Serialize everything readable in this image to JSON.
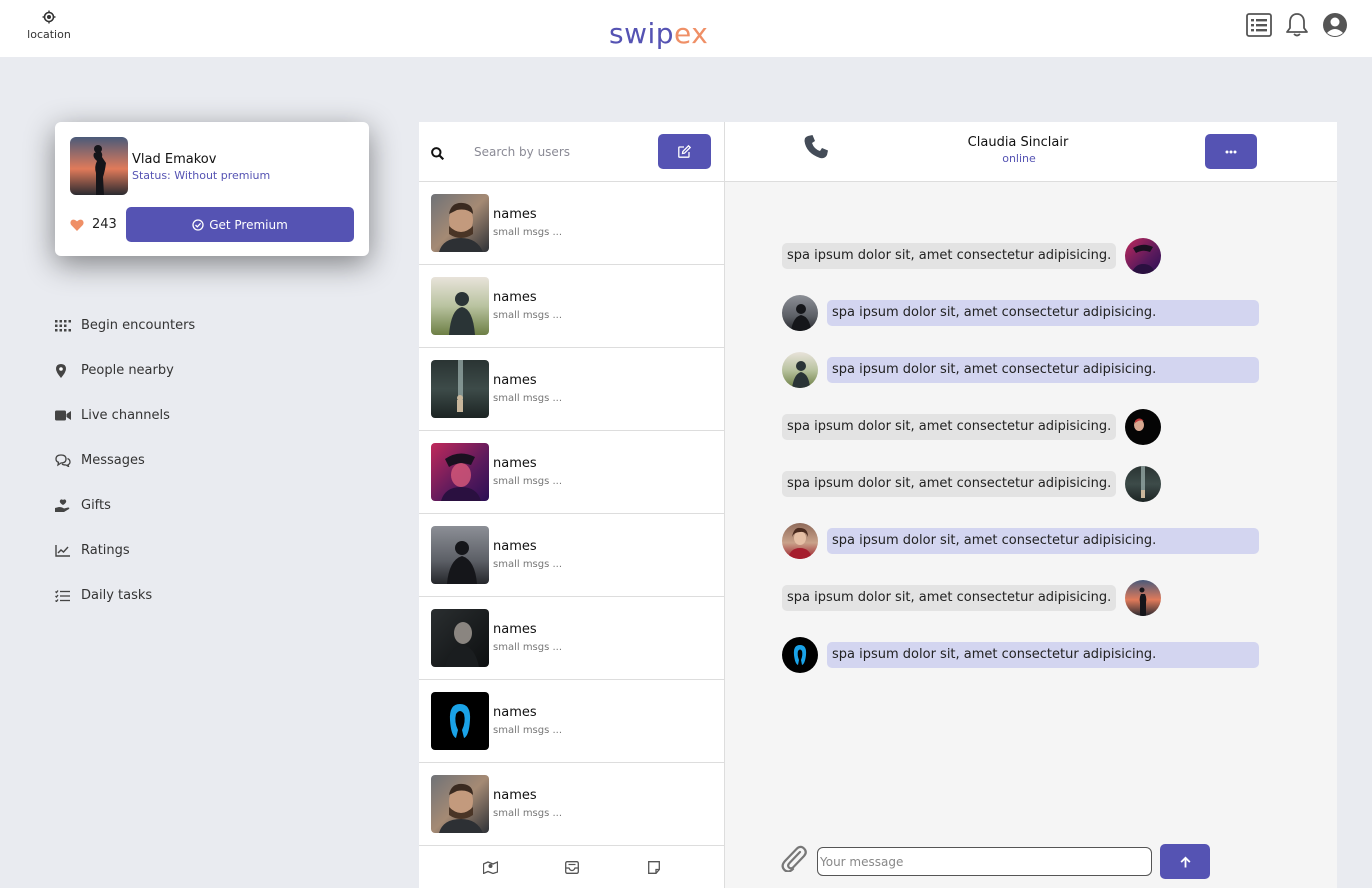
{
  "header": {
    "location_label": "location",
    "logo_part1": "swip",
    "logo_part2": "ex"
  },
  "profile": {
    "name": "Vlad Emakov",
    "status_label": "Status: Without premium",
    "likes": "243",
    "premium_button": "Get Premium"
  },
  "nav": {
    "items": [
      {
        "label": "Begin encounters",
        "icon": "grid-icon"
      },
      {
        "label": "People nearby",
        "icon": "map-pin-icon"
      },
      {
        "label": "Live channels",
        "icon": "video-camera-icon"
      },
      {
        "label": "Messages",
        "icon": "chat-bubbles-icon"
      },
      {
        "label": "Gifts",
        "icon": "hand-gift-icon"
      },
      {
        "label": "Ratings",
        "icon": "chart-line-icon"
      },
      {
        "label": "Daily tasks",
        "icon": "task-list-icon"
      }
    ]
  },
  "conversations": {
    "search_placeholder": "Search by users",
    "items": [
      {
        "name": "names",
        "preview": "small msgs ..."
      },
      {
        "name": "names",
        "preview": "small msgs ..."
      },
      {
        "name": "names",
        "preview": "small msgs ..."
      },
      {
        "name": "names",
        "preview": "small msgs ..."
      },
      {
        "name": "names",
        "preview": "small msgs ..."
      },
      {
        "name": "names",
        "preview": "small msgs ..."
      },
      {
        "name": "names",
        "preview": "small msgs ..."
      },
      {
        "name": "names",
        "preview": "small msgs ..."
      }
    ]
  },
  "chat": {
    "contact_name": "Claudia Sinclair",
    "contact_status": "online",
    "messages": [
      {
        "direction": "in",
        "text": "spa ipsum dolor sit, amet consectetur adipisicing."
      },
      {
        "direction": "out",
        "text": "spa ipsum dolor sit, amet consectetur adipisicing."
      },
      {
        "direction": "out",
        "text": "spa ipsum dolor sit, amet consectetur adipisicing."
      },
      {
        "direction": "in",
        "text": "spa ipsum dolor sit, amet consectetur adipisicing."
      },
      {
        "direction": "in",
        "text": "spa ipsum dolor sit, amet consectetur adipisicing."
      },
      {
        "direction": "out",
        "text": "spa ipsum dolor sit, amet consectetur adipisicing."
      },
      {
        "direction": "in",
        "text": "spa ipsum dolor sit, amet consectetur adipisicing."
      },
      {
        "direction": "out",
        "text": "spa ipsum dolor sit, amet consectetur adipisicing."
      }
    ],
    "input_placeholder": "Your message"
  },
  "colors": {
    "accent": "#5553b3",
    "logo_secondary": "#ef8f66",
    "background": "#e9ebf0",
    "incoming_bubble": "#e3e3e3",
    "outgoing_bubble": "#d3d5f0"
  }
}
